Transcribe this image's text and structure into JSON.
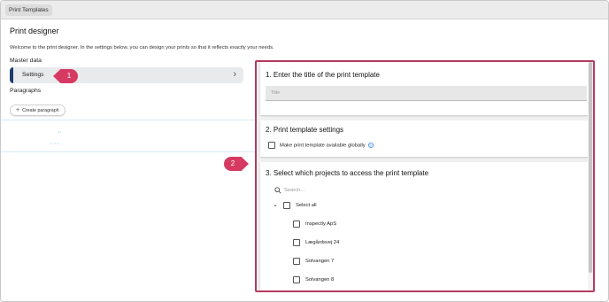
{
  "topbar": {
    "tab_label": "Print Templates"
  },
  "page": {
    "title": "Print designer",
    "welcome": "Welcome to the print designer. In the settings below, you can design your prints so that it reflects exactly your needs."
  },
  "master_data": {
    "label": "Master data",
    "settings_label": "Settings",
    "chevron_icon": "chevron-right-icon"
  },
  "paragraphs": {
    "label": "Paragraphs",
    "create_label": "Create paragraph"
  },
  "callouts": {
    "one": "1",
    "two": "2"
  },
  "section1": {
    "title": "1. Enter the title of the print template",
    "title_placeholder": "Title"
  },
  "section2": {
    "title": "2. Print template settings",
    "global_label": "Make print template available globally"
  },
  "section3": {
    "title": "3. Select which projects to access the print template",
    "search_placeholder": "Search...",
    "select_all": "Select all",
    "projects": [
      "Inspectly ApS",
      "Lægårdsvej 24",
      "Solvangen 7",
      "Solvangen 8"
    ]
  },
  "colors": {
    "callout": "#d63a62",
    "panel_border": "#b53a60",
    "settings_accent": "#1d3e6e"
  }
}
